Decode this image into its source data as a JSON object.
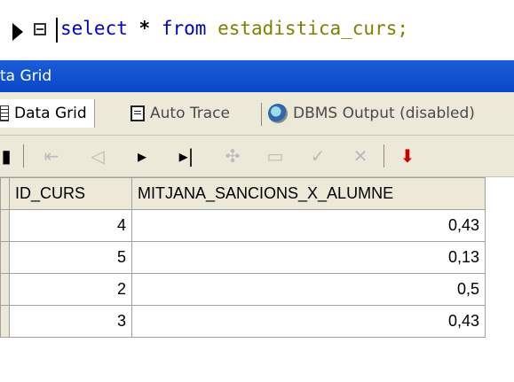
{
  "editor": {
    "sql_keyword_select": "select",
    "sql_star": "*",
    "sql_keyword_from": "from",
    "sql_table": "estadistica_curs;"
  },
  "panel": {
    "title": "ta Grid"
  },
  "tabs": [
    {
      "label": "Data Grid",
      "icon": "grid-icon"
    },
    {
      "label": "Auto Trace",
      "icon": "document-icon"
    },
    {
      "label": "DBMS Output (disabled)",
      "icon": "disc-icon"
    }
  ],
  "toolbar": {
    "buttons": [
      "first",
      "prior",
      "next",
      "last",
      "insert",
      "delete",
      "post",
      "cancel",
      "refresh"
    ]
  },
  "grid": {
    "columns": [
      "ID_CURS",
      "MITJANA_SANCIONS_X_ALUMNE"
    ],
    "rows": [
      [
        "4",
        "0,43"
      ],
      [
        "5",
        "0,13"
      ],
      [
        "2",
        "0,5"
      ],
      [
        "3",
        "0,43"
      ]
    ]
  },
  "colors": {
    "titlebar": "#0a47c8",
    "keyword": "#0000cc",
    "identifier": "#808000",
    "chrome": "#ece9d8"
  }
}
